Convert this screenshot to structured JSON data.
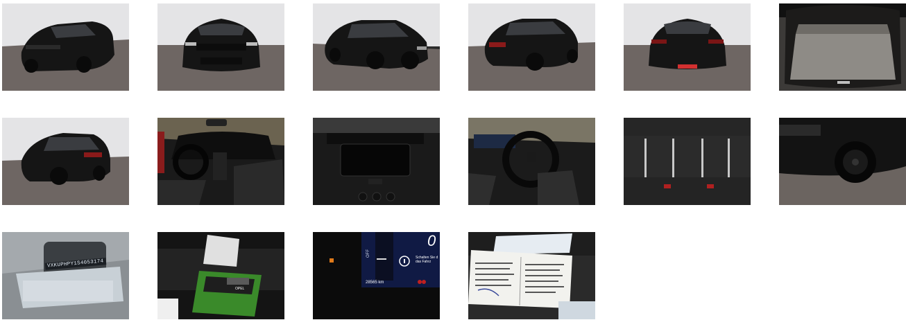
{
  "gallery": {
    "thumbnails": [
      {
        "name": "photo-front-left",
        "label": ""
      },
      {
        "name": "photo-front",
        "label": ""
      },
      {
        "name": "photo-side-front-right",
        "label": ""
      },
      {
        "name": "photo-rear-left",
        "label": ""
      },
      {
        "name": "photo-rear",
        "label": ""
      },
      {
        "name": "photo-trunk",
        "label": ""
      },
      {
        "name": "photo-rear-left-2",
        "label": ""
      },
      {
        "name": "photo-interior-cockpit",
        "label": ""
      },
      {
        "name": "photo-infotainment",
        "label": ""
      },
      {
        "name": "photo-steering-wheel",
        "label": ""
      },
      {
        "name": "photo-rear-seats",
        "label": ""
      },
      {
        "name": "photo-wheel-detail",
        "label": ""
      },
      {
        "name": "photo-vin-plate",
        "label": ""
      },
      {
        "name": "photo-documents-seat",
        "label": ""
      },
      {
        "name": "photo-dashboard-display",
        "label": ""
      },
      {
        "name": "photo-service-booklet",
        "label": ""
      }
    ],
    "vin": "VXKUPHPY1S4053174",
    "odometer": "28565 km",
    "display_off": "OFF",
    "display_info": "Schalten Sie d\ndas Fahrz",
    "opel_label": "OPEL"
  },
  "colors": {
    "background": "#ffffff",
    "car_body": "#141414",
    "floor": "#6b6360",
    "wall": "#dcdcde"
  }
}
